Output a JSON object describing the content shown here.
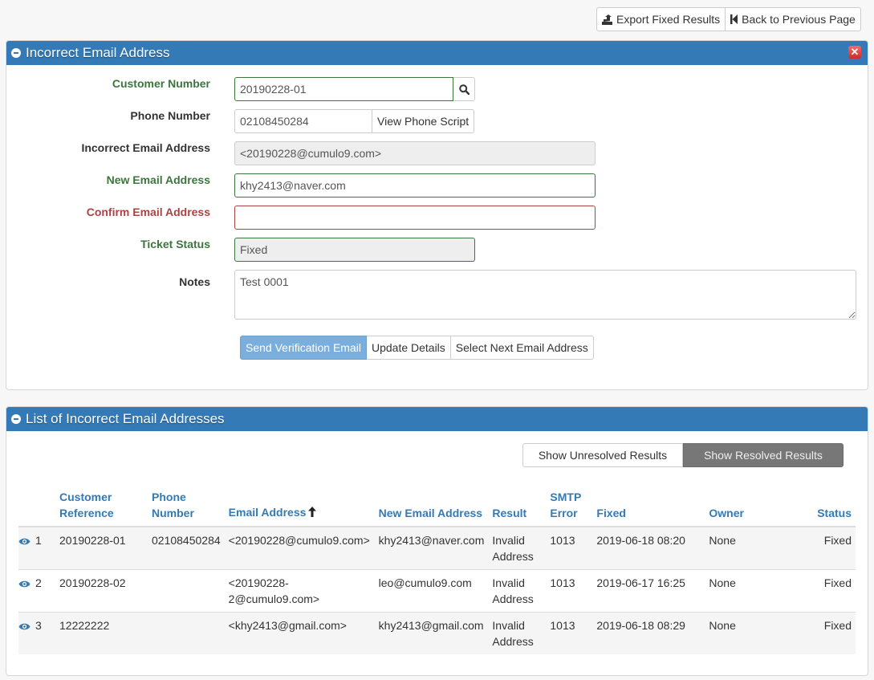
{
  "top_actions": {
    "export_label": "Export Fixed Results",
    "export_icon": "export-icon",
    "back_label": "Back to Previous Page",
    "back_icon": "step-backward-icon"
  },
  "edit_panel": {
    "title": "Incorrect Email Address",
    "collapse_icon": "minus-circle-icon",
    "close_icon": "close-icon",
    "fields": {
      "customer_number": {
        "label": "Customer Number",
        "value": "20190228-01",
        "state": "success"
      },
      "phone_number": {
        "label": "Phone Number",
        "value": "02108450284",
        "button": "View Phone Script"
      },
      "incorrect_email": {
        "label": "Incorrect Email Address",
        "value": "<20190228@cumulo9.com>",
        "readonly": true
      },
      "new_email": {
        "label": "New Email Address",
        "value": "khy2413@naver.com",
        "state": "success"
      },
      "confirm_email": {
        "label": "Confirm Email Address",
        "value": "",
        "state": "error"
      },
      "ticket_status": {
        "label": "Ticket Status",
        "value": "Fixed",
        "state": "success",
        "readonly": true
      },
      "notes": {
        "label": "Notes",
        "value": "Test 0001"
      }
    },
    "actions": {
      "send_verification": "Send Verification Email",
      "update_details": "Update Details",
      "select_next": "Select Next Email Address"
    }
  },
  "list_panel": {
    "title": "List of Incorrect Email Addresses",
    "collapse_icon": "minus-circle-icon",
    "toggle": {
      "unresolved": "Show Unresolved Results",
      "resolved": "Show Resolved Results",
      "active": "resolved"
    },
    "columns": {
      "customer_reference": "Customer Reference",
      "phone_number": "Phone Number",
      "email_address": "Email Address",
      "new_email_address": "New Email Address",
      "result": "Result",
      "smtp_error": "SMTP Error",
      "fixed": "Fixed",
      "owner": "Owner",
      "status": "Status"
    },
    "sort": {
      "column": "email_address",
      "direction": "ascending",
      "icon": "arrow-up-icon"
    },
    "rows": [
      {
        "index": "1",
        "customer_reference": "20190228-01",
        "phone_number": "02108450284",
        "email_address": "<20190228@cumulo9.com>",
        "new_email_address": "khy2413@naver.com",
        "result": "Invalid Address",
        "smtp_error": "1013",
        "fixed": "2019-06-18 08:20",
        "owner": "None",
        "status": "Fixed"
      },
      {
        "index": "2",
        "customer_reference": "20190228-02",
        "phone_number": "",
        "email_address": "<20190228-2@cumulo9.com>",
        "new_email_address": "leo@cumulo9.com",
        "result": "Invalid Address",
        "smtp_error": "1013",
        "fixed": "2019-06-17 16:25",
        "owner": "None",
        "status": "Fixed"
      },
      {
        "index": "3",
        "customer_reference": "12222222",
        "phone_number": "",
        "email_address": "<khy2413@gmail.com>",
        "new_email_address": "khy2413@gmail.com",
        "result": "Invalid Address",
        "smtp_error": "1013",
        "fixed": "2019-06-18 08:29",
        "owner": "None",
        "status": "Fixed"
      }
    ]
  },
  "colors": {
    "primary": "#337ab7",
    "success": "#3c763d",
    "error": "#a94442",
    "active_toggle": "#777777"
  }
}
